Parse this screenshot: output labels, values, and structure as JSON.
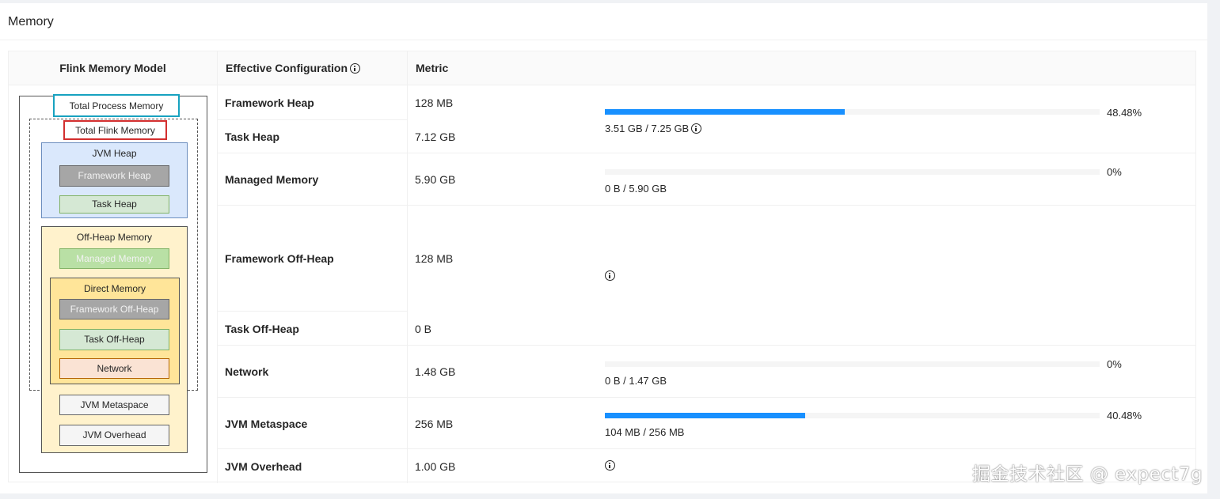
{
  "card": {
    "title": "Memory"
  },
  "table": {
    "headers": {
      "model": "Flink Memory Model",
      "config": "Effective Configuration",
      "metric": "Metric"
    },
    "rows": [
      {
        "name": "Framework Heap",
        "value": "128 MB"
      },
      {
        "name": "Task Heap",
        "value": "7.12 GB"
      },
      {
        "name": "Managed Memory",
        "value": "5.90 GB"
      },
      {
        "name": "Framework Off-Heap",
        "value": "128 MB"
      },
      {
        "name": "Task Off-Heap",
        "value": "0 B"
      },
      {
        "name": "Network",
        "value": "1.48 GB"
      },
      {
        "name": "JVM Metaspace",
        "value": "256 MB"
      },
      {
        "name": "JVM Overhead",
        "value": "1.00 GB"
      }
    ],
    "metrics": {
      "heap": {
        "percent_label": "48.48%",
        "percent": 48.48,
        "usage": "3.51 GB / 7.25 GB"
      },
      "managed": {
        "percent_label": "0%",
        "percent": 0,
        "usage": "0 B / 5.90 GB"
      },
      "network": {
        "percent_label": "0%",
        "percent": 0,
        "usage": "0 B / 1.47 GB"
      },
      "metaspace": {
        "percent_label": "40.48%",
        "percent": 40.48,
        "usage": "104 MB / 256 MB"
      }
    },
    "bar_color": "#1890ff"
  },
  "diagram": {
    "total_process": "Total Process Memory",
    "total_flink": "Total Flink Memory",
    "jvm_heap": "JVM Heap",
    "framework_heap": "Framework Heap",
    "task_heap": "Task Heap",
    "off_heap": "Off-Heap Memory",
    "managed_memory": "Managed Memory",
    "direct_memory": "Direct Memory",
    "framework_off_heap": "Framework Off-Heap",
    "task_off_heap": "Task Off-Heap",
    "network": "Network",
    "jvm_metaspace": "JVM Metaspace",
    "jvm_overhead": "JVM Overhead",
    "colors": {
      "total_process_border": "#17a2c0",
      "total_flink_border": "#d32f2f",
      "jvm_heap_bg": "#dae8fc",
      "off_heap_bg": "#fff2cc",
      "direct_bg": "#ffe599",
      "grey_box": "#a6a6a6",
      "green_box": "#d5e8d4",
      "managed_green": "#b9e0a5",
      "network_bg": "#fae3d4",
      "jvm_meta_bg": "#f5f5f5"
    }
  },
  "watermark": "掘金技术社区 @ expect7g"
}
